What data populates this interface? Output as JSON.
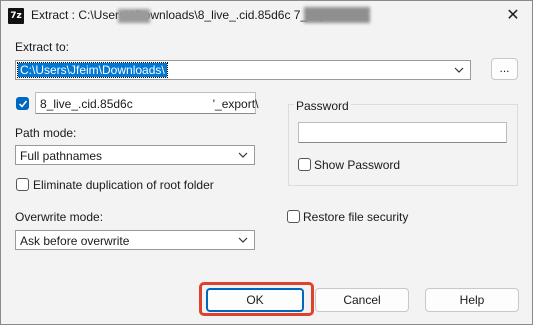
{
  "window": {
    "app_icon": "7z",
    "title": "Extract : C:\\Users\\      \\Downloads\\8_live_.cid.85d6c                     7_export.tar",
    "close_icon": "close-icon"
  },
  "extract_to": {
    "label": "Extract to:",
    "value": "C:\\Users\\Jfeim\\Downloads\\",
    "browse_label": "..."
  },
  "subfolder": {
    "checked": true,
    "value": "8_live_.cid.85d6c                        '_export\\"
  },
  "path_mode": {
    "label": "Path mode:",
    "value": "Full pathnames"
  },
  "eliminate_duplication": {
    "label": "Eliminate duplication of root folder",
    "checked": false
  },
  "overwrite_mode": {
    "label": "Overwrite mode:",
    "value": "Ask before overwrite"
  },
  "password": {
    "label": "Password",
    "value": "",
    "show_label": "Show Password",
    "show_checked": false
  },
  "restore_security": {
    "label": "Restore file security",
    "checked": false
  },
  "buttons": {
    "ok": "OK",
    "cancel": "Cancel",
    "help": "Help"
  },
  "colors": {
    "accent": "#0067c0",
    "selection": "#0078d4",
    "highlight": "#e0412a"
  }
}
